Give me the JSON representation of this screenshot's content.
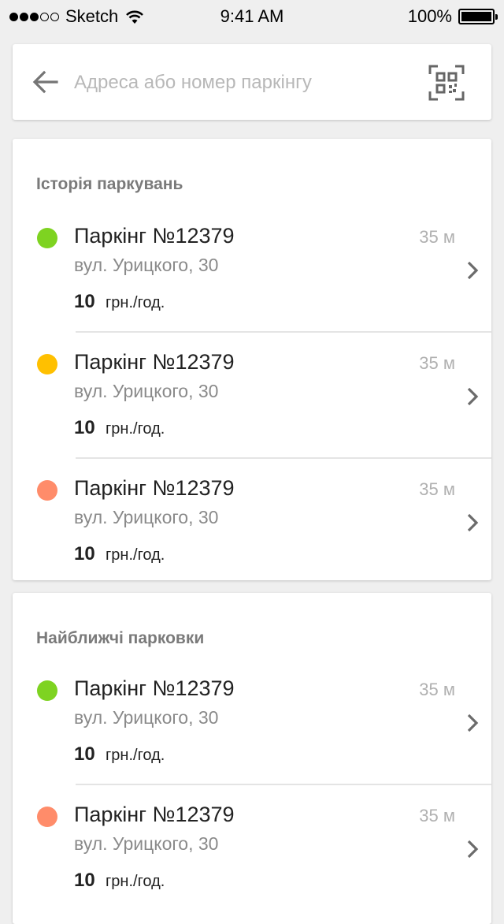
{
  "status_bar": {
    "carrier": "Sketch",
    "time": "9:41 AM",
    "battery": "100%"
  },
  "search": {
    "placeholder": "Адреса або номер паркінгу",
    "value": ""
  },
  "colors": {
    "green": "#7ed321",
    "yellow": "#ffc000",
    "orange": "#ff8c6a"
  },
  "history": {
    "title": "Історія паркувань",
    "items": [
      {
        "status": "green",
        "name": "Паркінг №12379",
        "address": "вул. Урицкого, 30",
        "price": "10",
        "unit": "грн./год.",
        "distance": "35 м"
      },
      {
        "status": "yellow",
        "name": "Паркінг №12379",
        "address": "вул. Урицкого, 30",
        "price": "10",
        "unit": "грн./год.",
        "distance": "35 м"
      },
      {
        "status": "orange",
        "name": "Паркінг №12379",
        "address": "вул. Урицкого, 30",
        "price": "10",
        "unit": "грн./год.",
        "distance": "35 м"
      }
    ]
  },
  "nearby": {
    "title": "Найближчі парковки",
    "items": [
      {
        "status": "green",
        "name": "Паркінг №12379",
        "address": "вул. Урицкого, 30",
        "price": "10",
        "unit": "грн./год.",
        "distance": "35 м"
      },
      {
        "status": "orange",
        "name": "Паркінг №12379",
        "address": "вул. Урицкого, 30",
        "price": "10",
        "unit": "грн./год.",
        "distance": "35 м"
      }
    ]
  }
}
